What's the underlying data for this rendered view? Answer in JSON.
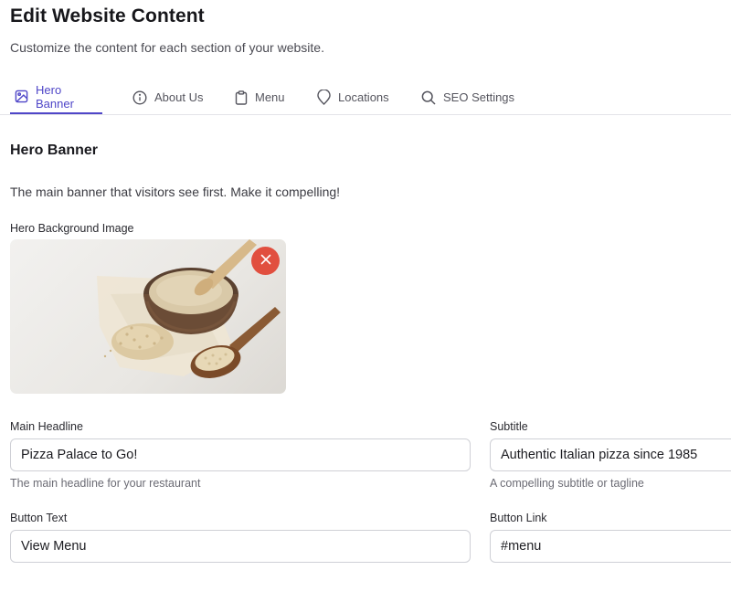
{
  "page": {
    "title": "Edit Website Content",
    "subtitle": "Customize the content for each section of your website."
  },
  "tabs": [
    {
      "label": "Hero Banner",
      "icon": "image-icon",
      "active": true
    },
    {
      "label": "About Us",
      "icon": "info-icon",
      "active": false
    },
    {
      "label": "Menu",
      "icon": "clipboard-icon",
      "active": false
    },
    {
      "label": "Locations",
      "icon": "map-pin-icon",
      "active": false
    },
    {
      "label": "SEO Settings",
      "icon": "search-icon",
      "active": false
    }
  ],
  "section": {
    "title": "Hero Banner",
    "description": "The main banner that visitors see first. Make it compelling!"
  },
  "hero_image": {
    "label": "Hero Background Image",
    "remove_icon": "close-icon"
  },
  "fields": {
    "main_headline": {
      "label": "Main Headline",
      "value": "Pizza Palace to Go!",
      "help": "The main headline for your restaurant"
    },
    "subtitle": {
      "label": "Subtitle",
      "value": "Authentic Italian pizza since 1985",
      "help": "A compelling subtitle or tagline"
    },
    "button_text": {
      "label": "Button Text",
      "value": "View Menu"
    },
    "button_link": {
      "label": "Button Link",
      "value": "#menu"
    }
  },
  "colors": {
    "accent": "#4f46c8",
    "danger": "#e14f3f",
    "border": "#cfd0d6"
  }
}
